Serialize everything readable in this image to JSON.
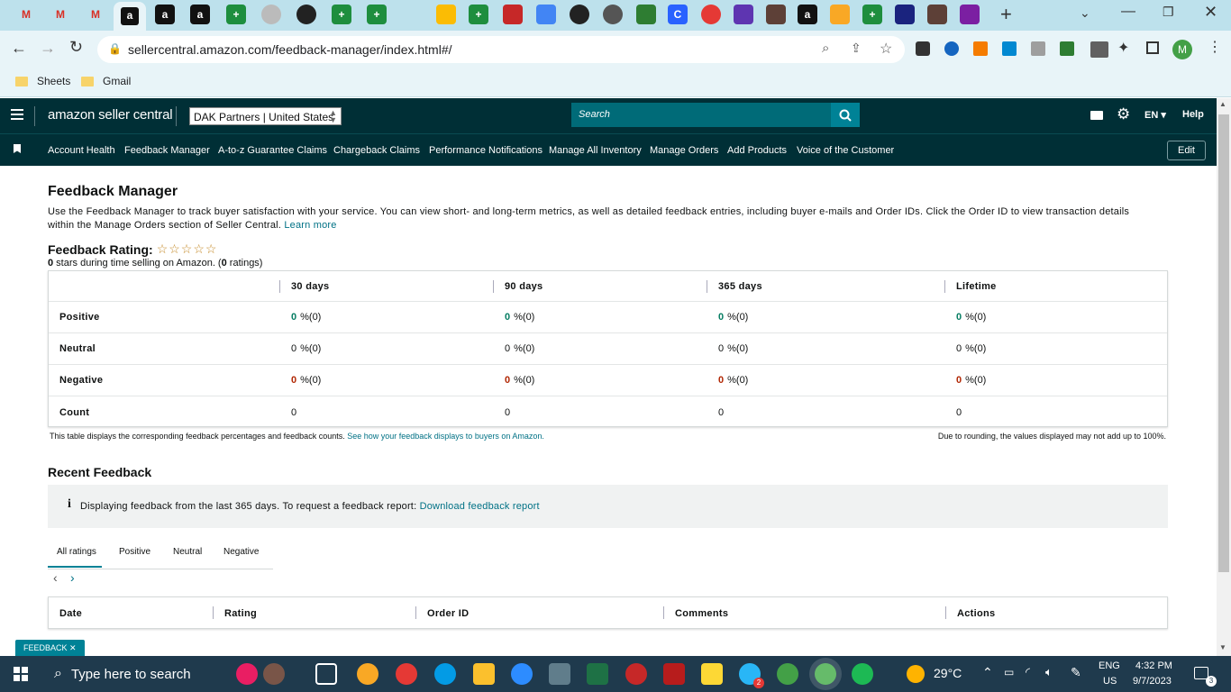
{
  "browser": {
    "url": "sellercentral.amazon.com/feedback-manager/index.html#/",
    "bookmarks": [
      "Sheets",
      "Gmail"
    ],
    "profile_initial": "M"
  },
  "header": {
    "logo_text": "amazon seller central",
    "account": "DAK Partners | United States",
    "search_placeholder": "Search",
    "language": "EN",
    "help": "Help"
  },
  "nav": {
    "items": [
      "Account Health",
      "Feedback Manager",
      "A-to-z Guarantee Claims",
      "Chargeback Claims",
      "Performance Notifications",
      "Manage All Inventory",
      "Manage Orders",
      "Add Products",
      "Voice of the Customer"
    ],
    "edit": "Edit"
  },
  "page": {
    "title": "Feedback Manager",
    "description": "Use the Feedback Manager to track buyer satisfaction with your service. You can view short- and long-term metrics, as well as detailed feedback entries, including buyer e-mails and Order IDs. Click the Order ID to view transaction details within the Manage Orders section of Seller Central.",
    "learn_more": "Learn more",
    "rating_label": "Feedback Rating:",
    "rating_stars": 0,
    "rating_summary_value": "0",
    "rating_summary_mid": " stars during time selling on Amazon. (",
    "rating_count": "0",
    "rating_summary_end": " ratings)"
  },
  "feedback_table": {
    "columns": [
      "30 days",
      "90 days",
      "365 days",
      "Lifetime"
    ],
    "rows": [
      {
        "label": "Positive",
        "values": [
          "0",
          "0",
          "0",
          "0"
        ],
        "counts": [
          "%(0)",
          "%(0)",
          "%(0)",
          "%(0)"
        ],
        "color": "#067d62"
      },
      {
        "label": "Neutral",
        "values": [
          "0",
          "0",
          "0",
          "0"
        ],
        "counts": [
          "%(0)",
          "%(0)",
          "%(0)",
          "%(0)"
        ],
        "color": "#0f1111"
      },
      {
        "label": "Negative",
        "values": [
          "0",
          "0",
          "0",
          "0"
        ],
        "counts": [
          "%(0)",
          "%(0)",
          "%(0)",
          "%(0)"
        ],
        "color": "#b12704"
      },
      {
        "label": "Count",
        "values": [
          "0",
          "0",
          "0",
          "0"
        ],
        "counts": [
          "",
          "",
          "",
          ""
        ],
        "color": "#0f1111"
      }
    ],
    "footnote": "This table displays the corresponding feedback percentages and feedback counts.",
    "footnote_link": "See how your feedback displays to buyers on Amazon.",
    "rounding_note": "Due to rounding, the values displayed may not add up to 100%."
  },
  "recent": {
    "title": "Recent Feedback",
    "info": "Displaying feedback from the last 365 days. To request a feedback report:",
    "info_link": "Download feedback report",
    "tabs": [
      "All ratings",
      "Positive",
      "Neutral",
      "Negative"
    ],
    "columns": [
      "Date",
      "Rating",
      "Order ID",
      "Comments",
      "Actions"
    ]
  },
  "feedback_button": "FEEDBACK",
  "taskbar": {
    "search_placeholder": "Type here to search",
    "weather": "29°C",
    "lang": "ENG",
    "region": "US",
    "time": "4:32 PM",
    "date": "9/7/2023",
    "notifications": "3",
    "chrome_badge": "2"
  },
  "colors": {
    "header": "#002f36",
    "link": "#007185",
    "positive": "#067d62",
    "negative": "#b12704"
  }
}
